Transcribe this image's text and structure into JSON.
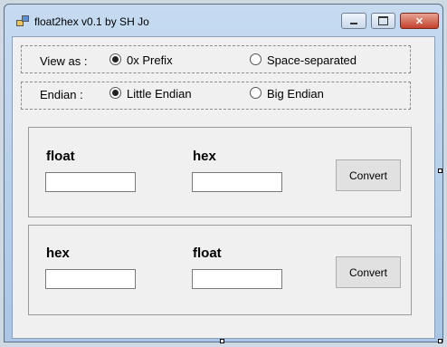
{
  "window": {
    "title": "float2hex v0.1 by SH Jo"
  },
  "view_as": {
    "label": "View as :",
    "options": [
      {
        "label": "0x Prefix",
        "checked": true
      },
      {
        "label": "Space-separated",
        "checked": false
      }
    ]
  },
  "endian": {
    "label": "Endian :",
    "options": [
      {
        "label": "Little Endian",
        "checked": true
      },
      {
        "label": "Big Endian",
        "checked": false
      }
    ]
  },
  "float_to_hex": {
    "input_label": "float",
    "input_value": "",
    "output_label": "hex",
    "output_value": "",
    "button_label": "Convert"
  },
  "hex_to_float": {
    "input_label": "hex",
    "input_value": "",
    "output_label": "float",
    "output_value": "",
    "button_label": "Convert"
  }
}
